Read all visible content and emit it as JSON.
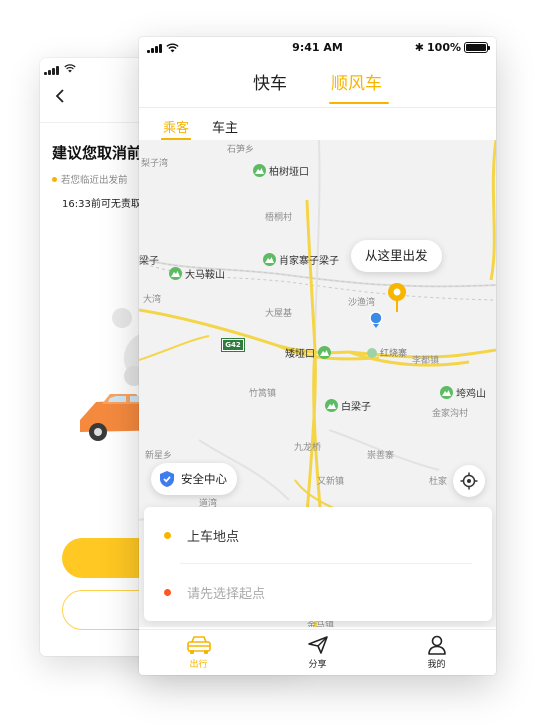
{
  "back_screen": {
    "title": "建议您取消前",
    "notice": "若您临近出发前",
    "free_cancel": "16:33前可无责取"
  },
  "status_bar": {
    "time": "9:41 AM",
    "battery": "100%",
    "battery_level": 1.0
  },
  "service_tabs": [
    {
      "label": "快车",
      "active": false
    },
    {
      "label": "顺风车",
      "active": true
    }
  ],
  "role_tabs": [
    {
      "label": "乘客",
      "active": true
    },
    {
      "label": "车主",
      "active": false
    }
  ],
  "map": {
    "places": [
      "石笋乡",
      "梨子湾",
      "梧桐村",
      "梁子",
      "大湾",
      "大屋基",
      "沙渔湾",
      "竹篙镇",
      "九龙桥",
      "又新镇",
      "崇善寨",
      "金家沟村",
      "杜家",
      "新星乡",
      "道湾",
      "李都镇",
      "金马镇"
    ],
    "pois": [
      "柏树垭口",
      "肖家寨子梁子",
      "大马鞍山",
      "矮垭口",
      "红烧寨",
      "白梁子",
      "垮鸡山"
    ],
    "road_badge": "G42",
    "depart_hint": "从这里出发",
    "safety_center": "安全中心"
  },
  "address_card": {
    "pickup": "上车地点",
    "start_placeholder": "请先选择起点"
  },
  "tab_bar": [
    {
      "label": "出行",
      "icon": "car-icon",
      "active": true
    },
    {
      "label": "分享",
      "icon": "send-icon",
      "active": false
    },
    {
      "label": "我的",
      "icon": "person-icon",
      "active": false
    }
  ],
  "colors": {
    "accent": "#f7b500",
    "start_dot": "#ff5722",
    "poi_green": "#5dbb63",
    "location_blue": "#3d8be8"
  }
}
